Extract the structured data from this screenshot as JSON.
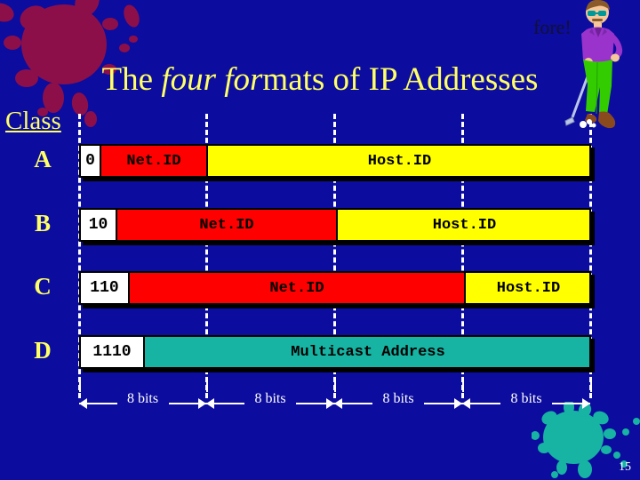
{
  "slide": {
    "title_prefix": "The ",
    "title_italic": "four for",
    "title_suffix": "mats of IP Addresses",
    "class_label": "Class",
    "fore_text": "fore!",
    "page_number": "15",
    "background_color": "#0c0c9e",
    "title_color": "#ffff66"
  },
  "rows": [
    {
      "class": "A",
      "prefix": "0",
      "segments": [
        {
          "label": "Net.ID",
          "role": "netid",
          "color": "#ff0000"
        },
        {
          "label": "Host.ID",
          "role": "hostid",
          "color": "#ffff00"
        }
      ]
    },
    {
      "class": "B",
      "prefix": "10",
      "segments": [
        {
          "label": "Net.ID",
          "role": "netid",
          "color": "#ff0000"
        },
        {
          "label": "Host.ID",
          "role": "hostid",
          "color": "#ffff00"
        }
      ]
    },
    {
      "class": "C",
      "prefix": "110",
      "segments": [
        {
          "label": "Net.ID",
          "role": "netid",
          "color": "#ff0000"
        },
        {
          "label": "Host.ID",
          "role": "hostid",
          "color": "#ffff00"
        }
      ]
    },
    {
      "class": "D",
      "prefix": "1110",
      "segments": [
        {
          "label": "Multicast Address",
          "role": "mcast",
          "color": "#17b3a3"
        }
      ]
    }
  ],
  "ruler": {
    "labels": [
      "8 bits",
      "8 bits",
      "8 bits",
      "8 bits"
    ]
  },
  "decor": {
    "splat_top_left_color": "#8c0f4a",
    "splat_bottom_right_color": "#17b3a3",
    "golfer_shirt_color": "#9933cc",
    "golfer_pants_color": "#33cc00",
    "golfer_shoe_color": "#8b4a1e",
    "golfer_glasses_color": "#009999"
  }
}
